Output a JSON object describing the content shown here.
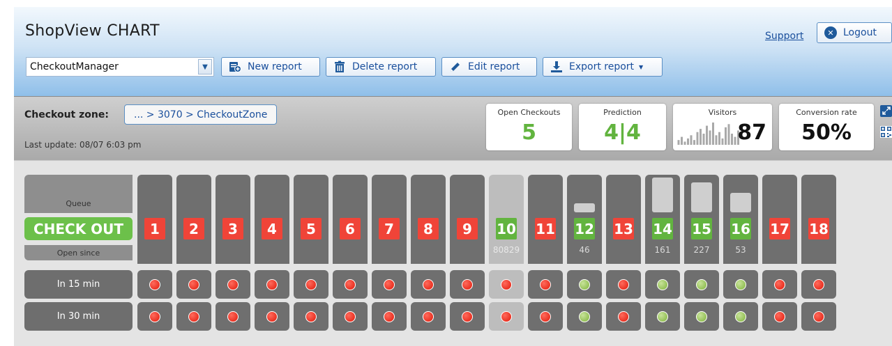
{
  "app": {
    "title": "ShopView CHART"
  },
  "header": {
    "support_label": "Support",
    "logout_label": "Logout",
    "report_select": {
      "value": "CheckoutManager"
    },
    "buttons": {
      "new_report": "New report",
      "delete_report": "Delete report",
      "edit_report": "Edit report",
      "export_report": "Export report"
    }
  },
  "zone": {
    "label": "Checkout zone:",
    "path": "... > 3070 > CheckoutZone",
    "last_update": "Last update: 08/07 6:03 pm"
  },
  "kpis": {
    "open_checkouts": {
      "label": "Open Checkouts",
      "value": "5"
    },
    "prediction": {
      "label": "Prediction",
      "value": "4|4"
    },
    "visitors": {
      "label": "Visitors",
      "value": "87",
      "sparkline": [
        3,
        5,
        2,
        4,
        6,
        3,
        8,
        10,
        7,
        12,
        9,
        14,
        6,
        8,
        4,
        11,
        13,
        7,
        5,
        9
      ]
    },
    "conversion_rate": {
      "label": "Conversion rate",
      "value": "50%"
    }
  },
  "colors": {
    "open": "#62b43f",
    "closed": "#f04438",
    "header_blue": "#8fbfe9"
  },
  "grid": {
    "row_labels": {
      "queue": "Queue",
      "checkout": "CHECK OUT",
      "open_since": "Open since",
      "in15": "In 15 min",
      "in30": "In 30 min"
    },
    "checkouts": [
      {
        "id": "1",
        "status": "closed",
        "queue": 0,
        "open_since": "",
        "in15": "red",
        "in30": "red"
      },
      {
        "id": "2",
        "status": "closed",
        "queue": 0,
        "open_since": "",
        "in15": "red",
        "in30": "red"
      },
      {
        "id": "3",
        "status": "closed",
        "queue": 0,
        "open_since": "",
        "in15": "red",
        "in30": "red"
      },
      {
        "id": "4",
        "status": "closed",
        "queue": 0,
        "open_since": "",
        "in15": "red",
        "in30": "red"
      },
      {
        "id": "5",
        "status": "closed",
        "queue": 0,
        "open_since": "",
        "in15": "red",
        "in30": "red"
      },
      {
        "id": "6",
        "status": "closed",
        "queue": 0,
        "open_since": "",
        "in15": "red",
        "in30": "red"
      },
      {
        "id": "7",
        "status": "closed",
        "queue": 0,
        "open_since": "",
        "in15": "red",
        "in30": "red"
      },
      {
        "id": "8",
        "status": "closed",
        "queue": 0,
        "open_since": "",
        "in15": "red",
        "in30": "red"
      },
      {
        "id": "9",
        "status": "closed",
        "queue": 0,
        "open_since": "",
        "in15": "red",
        "in30": "red"
      },
      {
        "id": "10",
        "status": "open",
        "queue": 0,
        "open_since": "80829",
        "in15": "red",
        "in30": "red",
        "inactive": true
      },
      {
        "id": "11",
        "status": "closed",
        "queue": 0,
        "open_since": "",
        "in15": "red",
        "in30": "red"
      },
      {
        "id": "12",
        "status": "open",
        "queue": 0.25,
        "open_since": "46",
        "in15": "green",
        "in30": "green"
      },
      {
        "id": "13",
        "status": "closed",
        "queue": 0,
        "open_since": "",
        "in15": "red",
        "in30": "red"
      },
      {
        "id": "14",
        "status": "open",
        "queue": 1.0,
        "open_since": "161",
        "in15": "green",
        "in30": "green"
      },
      {
        "id": "15",
        "status": "open",
        "queue": 0.85,
        "open_since": "227",
        "in15": "green",
        "in30": "green"
      },
      {
        "id": "16",
        "status": "open",
        "queue": 0.55,
        "open_since": "53",
        "in15": "green",
        "in30": "green"
      },
      {
        "id": "17",
        "status": "closed",
        "queue": 0,
        "open_since": "",
        "in15": "red",
        "in30": "red"
      },
      {
        "id": "18",
        "status": "closed",
        "queue": 0,
        "open_since": "",
        "in15": "red",
        "in30": "red"
      }
    ]
  }
}
